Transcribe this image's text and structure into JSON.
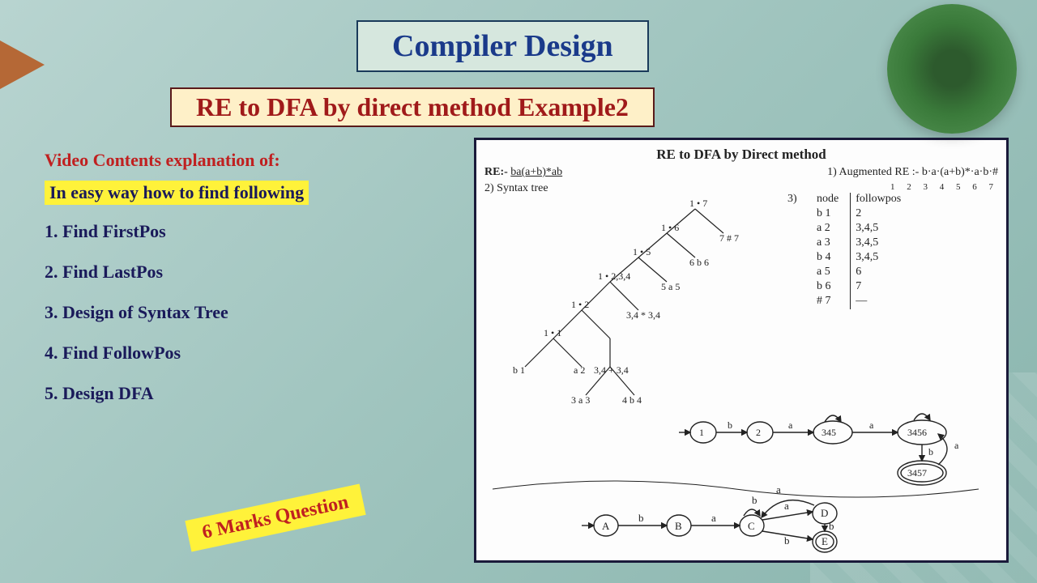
{
  "title": "Compiler Design",
  "subtitle": "RE to DFA by direct method Example2",
  "content": {
    "heading": "Video Contents explanation of:",
    "highlight": "In easy way how to find following",
    "items": [
      "1.  Find FirstPos",
      "2.  Find LastPos",
      "3.  Design of Syntax Tree",
      "4.  Find FollowPos",
      "5.  Design DFA"
    ]
  },
  "marks_badge": "6 Marks Question",
  "diagram": {
    "heading": "RE to DFA by Direct method",
    "re_label": "RE:-",
    "re_value": "ba(a+b)*ab",
    "aug_label": "1) Augmented RE :-",
    "aug_value": "b·a·(a+b)*·a·b·#",
    "aug_positions": "1 2  3 4  5 6 7",
    "step2": "2) Syntax tree",
    "step3": "3)",
    "followpos_header": [
      "node",
      "followpos"
    ],
    "followpos_rows": [
      [
        "b",
        "1",
        "2"
      ],
      [
        "a",
        "2",
        "3,4,5"
      ],
      [
        "a",
        "3",
        "3,4,5"
      ],
      [
        "b",
        "4",
        "3,4,5"
      ],
      [
        "a",
        "5",
        "6"
      ],
      [
        "b",
        "6",
        "7"
      ],
      [
        "#",
        "7",
        "—"
      ]
    ],
    "dfa_numeric_states": [
      "1",
      "2",
      "345",
      "3456",
      "3457"
    ],
    "dfa_letter_states": [
      "A",
      "B",
      "C",
      "D",
      "E"
    ],
    "syntax_leaves": [
      {
        "sym": "b",
        "pos": "1"
      },
      {
        "sym": "a",
        "pos": "2"
      },
      {
        "sym": "a",
        "pos": "3"
      },
      {
        "sym": "b",
        "pos": "4"
      },
      {
        "sym": "a",
        "pos": "5"
      },
      {
        "sym": "b",
        "pos": "6"
      },
      {
        "sym": "#",
        "pos": "7"
      }
    ]
  }
}
